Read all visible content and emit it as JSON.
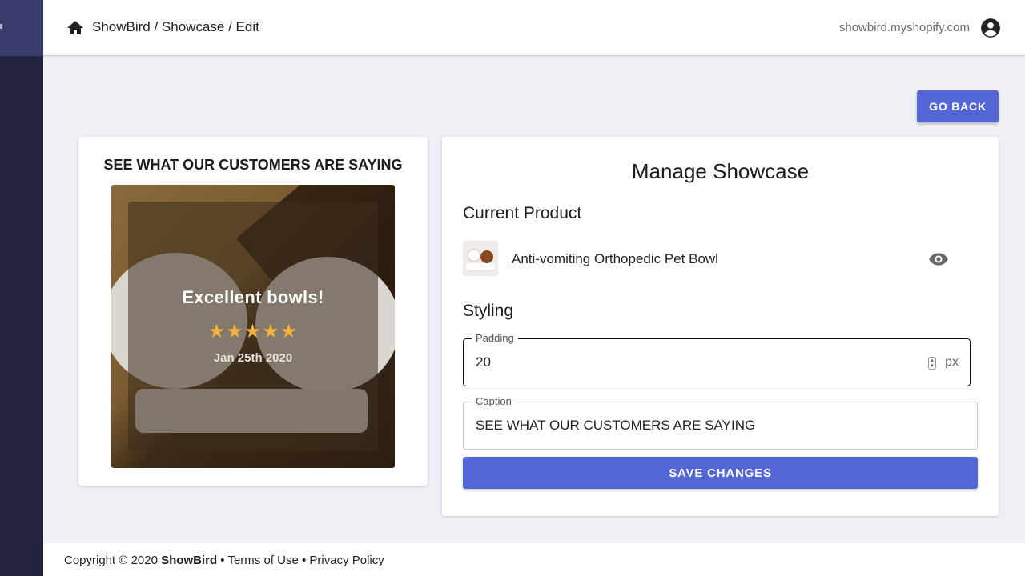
{
  "header": {
    "breadcrumb": "ShowBird / Showcase / Edit",
    "shop_domain": "showbird.myshopify.com",
    "icons": {
      "home": "home-icon",
      "account": "account-circle-icon"
    }
  },
  "actions": {
    "go_back_label": "GO BACK"
  },
  "preview": {
    "caption": "SEE WHAT OUR CUSTOMERS ARE SAYING",
    "review_title": "Excellent bowls!",
    "stars": "★★★★★",
    "rating": 5,
    "review_date": "Jan 25th 2020"
  },
  "manage": {
    "title": "Manage Showcase",
    "current_product_heading": "Current Product",
    "product_name": "Anti-vomiting Orthopedic Pet Bowl",
    "styling_heading": "Styling",
    "padding": {
      "label": "Padding",
      "value": "20",
      "unit": "px"
    },
    "caption": {
      "label": "Caption",
      "value": "SEE WHAT OUR CUSTOMERS ARE SAYING"
    },
    "save_label": "SAVE CHANGES"
  },
  "footer": {
    "copyright": "Copyright © 2020",
    "brand": "ShowBird",
    "sep1": " • ",
    "terms": "Terms of Use",
    "sep2": " • ",
    "privacy": "Privacy Policy"
  },
  "colors": {
    "accent": "#5466d6",
    "sidebar": "#23243f",
    "star": "#f3b33d",
    "background": "#eff0f6"
  }
}
